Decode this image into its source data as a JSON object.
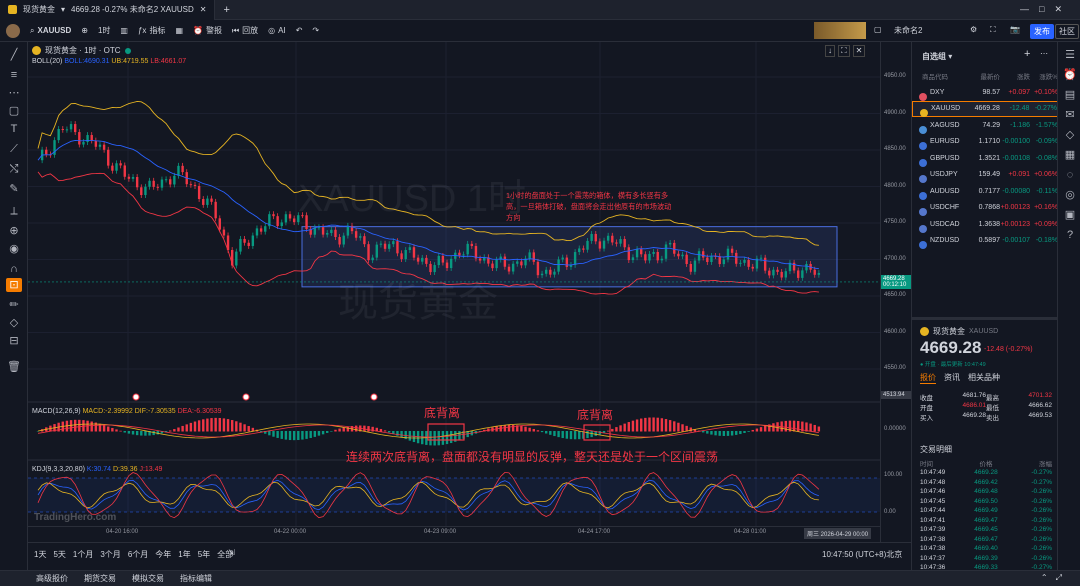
{
  "window": {
    "tab_title": "现货黄金",
    "tab_info": "4669.28 -0.27% 未命名2 XAUUSD",
    "new_tab": "+"
  },
  "toolbar": {
    "symbol": "XAUUSD",
    "interval": "1时",
    "indicators": "指标",
    "alerts": "警报",
    "replay": "回放",
    "ai": "AI",
    "layout_name": "未命名2",
    "publish": "发布",
    "community": "社区"
  },
  "chart": {
    "title": "现货黄金 · 1时 · OTC",
    "boll": "BOLL(20)",
    "boll_mid": "BOLL:4690.31",
    "boll_ub": "UB:4719.55",
    "boll_lb": "LB:4661.07",
    "watermark_sym": "XAUUSD 1时",
    "watermark_name": "现货黄金",
    "annotation": "1小时的盘面处于一个震荡的箱体，横有多长竖有多高，一旦箱体打破，盘面将会走出他原有的市场波动方向",
    "price_label": "4669.28",
    "countdown": "00:12:10",
    "cursor_price": "4513.94",
    "brand": "TradingHero.com"
  },
  "macd": {
    "label": "MACD(12,26,9)",
    "macd": "MACD:-2.39992",
    "dif": "DIF:-7.30535",
    "dea": "DEA:-6.30539",
    "axis": "0.00000",
    "note1": "底背离",
    "note2": "底背离",
    "summary": "连续两次底背离，盘面都没有明显的反弹，整天还是处于一个区间震荡"
  },
  "kdj": {
    "label": "KDJ(9,3,3,20,80)",
    "k": "K:30.74",
    "d": "D:39.36",
    "j": "J:13.49",
    "ax100": "100.00",
    "ax0": "0.00"
  },
  "price_axis": [
    "4950.00",
    "4900.00",
    "4850.00",
    "4800.00",
    "4750.00",
    "4700.00",
    "4650.00",
    "4600.00",
    "4550.00"
  ],
  "time_axis": [
    "04-20 16:00",
    "04-22 00:00",
    "04-23 09:00",
    "04-24 17:00",
    "04-28 01:00"
  ],
  "time_cursor": "周三  2026-04-29  00:00",
  "ranges": [
    "1天",
    "5天",
    "1个月",
    "3个月",
    "6个月",
    "今年",
    "1年",
    "5年",
    "全部"
  ],
  "clock": "10:47:50 (UTC+8)北京",
  "footer": [
    "高级报价",
    "期货交易",
    "模拟交易",
    "指标编辑"
  ],
  "watchlist": {
    "title": "自选组",
    "headers": [
      "商品代码",
      "最新价",
      "涨跌",
      "涨跌%"
    ],
    "rows": [
      {
        "sym": "DXY",
        "price": "98.57",
        "c": "+0.097",
        "pc": "+0.10%",
        "color": "#e05060",
        "dir": "red"
      },
      {
        "sym": "XAUUSD",
        "price": "4669.28",
        "c": "-12.48",
        "pc": "-0.27%",
        "color": "#e6b422",
        "dir": "green"
      },
      {
        "sym": "XAGUSD",
        "price": "74.29",
        "c": "-1.186",
        "pc": "-1.57%",
        "color": "#4a8fd6",
        "dir": "green"
      },
      {
        "sym": "EURUSD",
        "price": "1.1710",
        "c": "-0.00100",
        "pc": "-0.09%",
        "color": "#3c6fd6",
        "dir": "green"
      },
      {
        "sym": "GBPUSD",
        "price": "1.3521",
        "c": "-0.00108",
        "pc": "-0.08%",
        "color": "#3c6fd6",
        "dir": "green"
      },
      {
        "sym": "USDJPY",
        "price": "159.49",
        "c": "+0.091",
        "pc": "+0.06%",
        "color": "#5577cc",
        "dir": "red"
      },
      {
        "sym": "AUDUSD",
        "price": "0.7177",
        "c": "-0.00080",
        "pc": "-0.11%",
        "color": "#3c6fd6",
        "dir": "green"
      },
      {
        "sym": "USDCHF",
        "price": "0.7868",
        "c": "+0.00123",
        "pc": "+0.16%",
        "color": "#5577cc",
        "dir": "red"
      },
      {
        "sym": "USDCAD",
        "price": "1.3638",
        "c": "+0.00123",
        "pc": "+0.09%",
        "color": "#5577cc",
        "dir": "red"
      },
      {
        "sym": "NZDUSD",
        "price": "0.5897",
        "c": "-0.00107",
        "pc": "-0.18%",
        "color": "#3c6fd6",
        "dir": "green"
      }
    ]
  },
  "detail": {
    "name": "现货黄金",
    "sym": "XAUUSD",
    "price": "4669.28",
    "change": "-12.48 (-0.27%)",
    "status": "● 开盘 · 最后更新 10:47:49",
    "tabs": [
      "报价",
      "资讯",
      "相关品种"
    ],
    "stats": [
      [
        "收盘",
        "4681.76",
        "最高",
        "4701.32"
      ],
      [
        "开盘",
        "4686.01",
        "最低",
        "4666.62"
      ],
      [
        "买入",
        "4669.28",
        "卖出",
        "4669.53"
      ]
    ],
    "trades_title": "交易明细",
    "trade_headers": [
      "时间",
      "价格",
      "涨幅"
    ],
    "trades": [
      [
        "10:47:49",
        "4669.28",
        "-0.27%"
      ],
      [
        "10:47:48",
        "4669.42",
        "-0.27%"
      ],
      [
        "10:47:46",
        "4669.48",
        "-0.26%"
      ],
      [
        "10:47:45",
        "4669.50",
        "-0.26%"
      ],
      [
        "10:47:44",
        "4669.49",
        "-0.26%"
      ],
      [
        "10:47:41",
        "4669.47",
        "-0.26%"
      ],
      [
        "10:47:39",
        "4669.45",
        "-0.26%"
      ],
      [
        "10:47:38",
        "4669.47",
        "-0.26%"
      ],
      [
        "10:47:38",
        "4669.40",
        "-0.26%"
      ],
      [
        "10:47:37",
        "4669.39",
        "-0.26%"
      ],
      [
        "10:47:36",
        "4669.33",
        "-0.27%"
      ]
    ]
  },
  "colors": {
    "up": "#089981",
    "down": "#f23645",
    "boll_mid": "#2962ff",
    "boll_band": "#e6b422",
    "box": "#4a6ee0"
  }
}
